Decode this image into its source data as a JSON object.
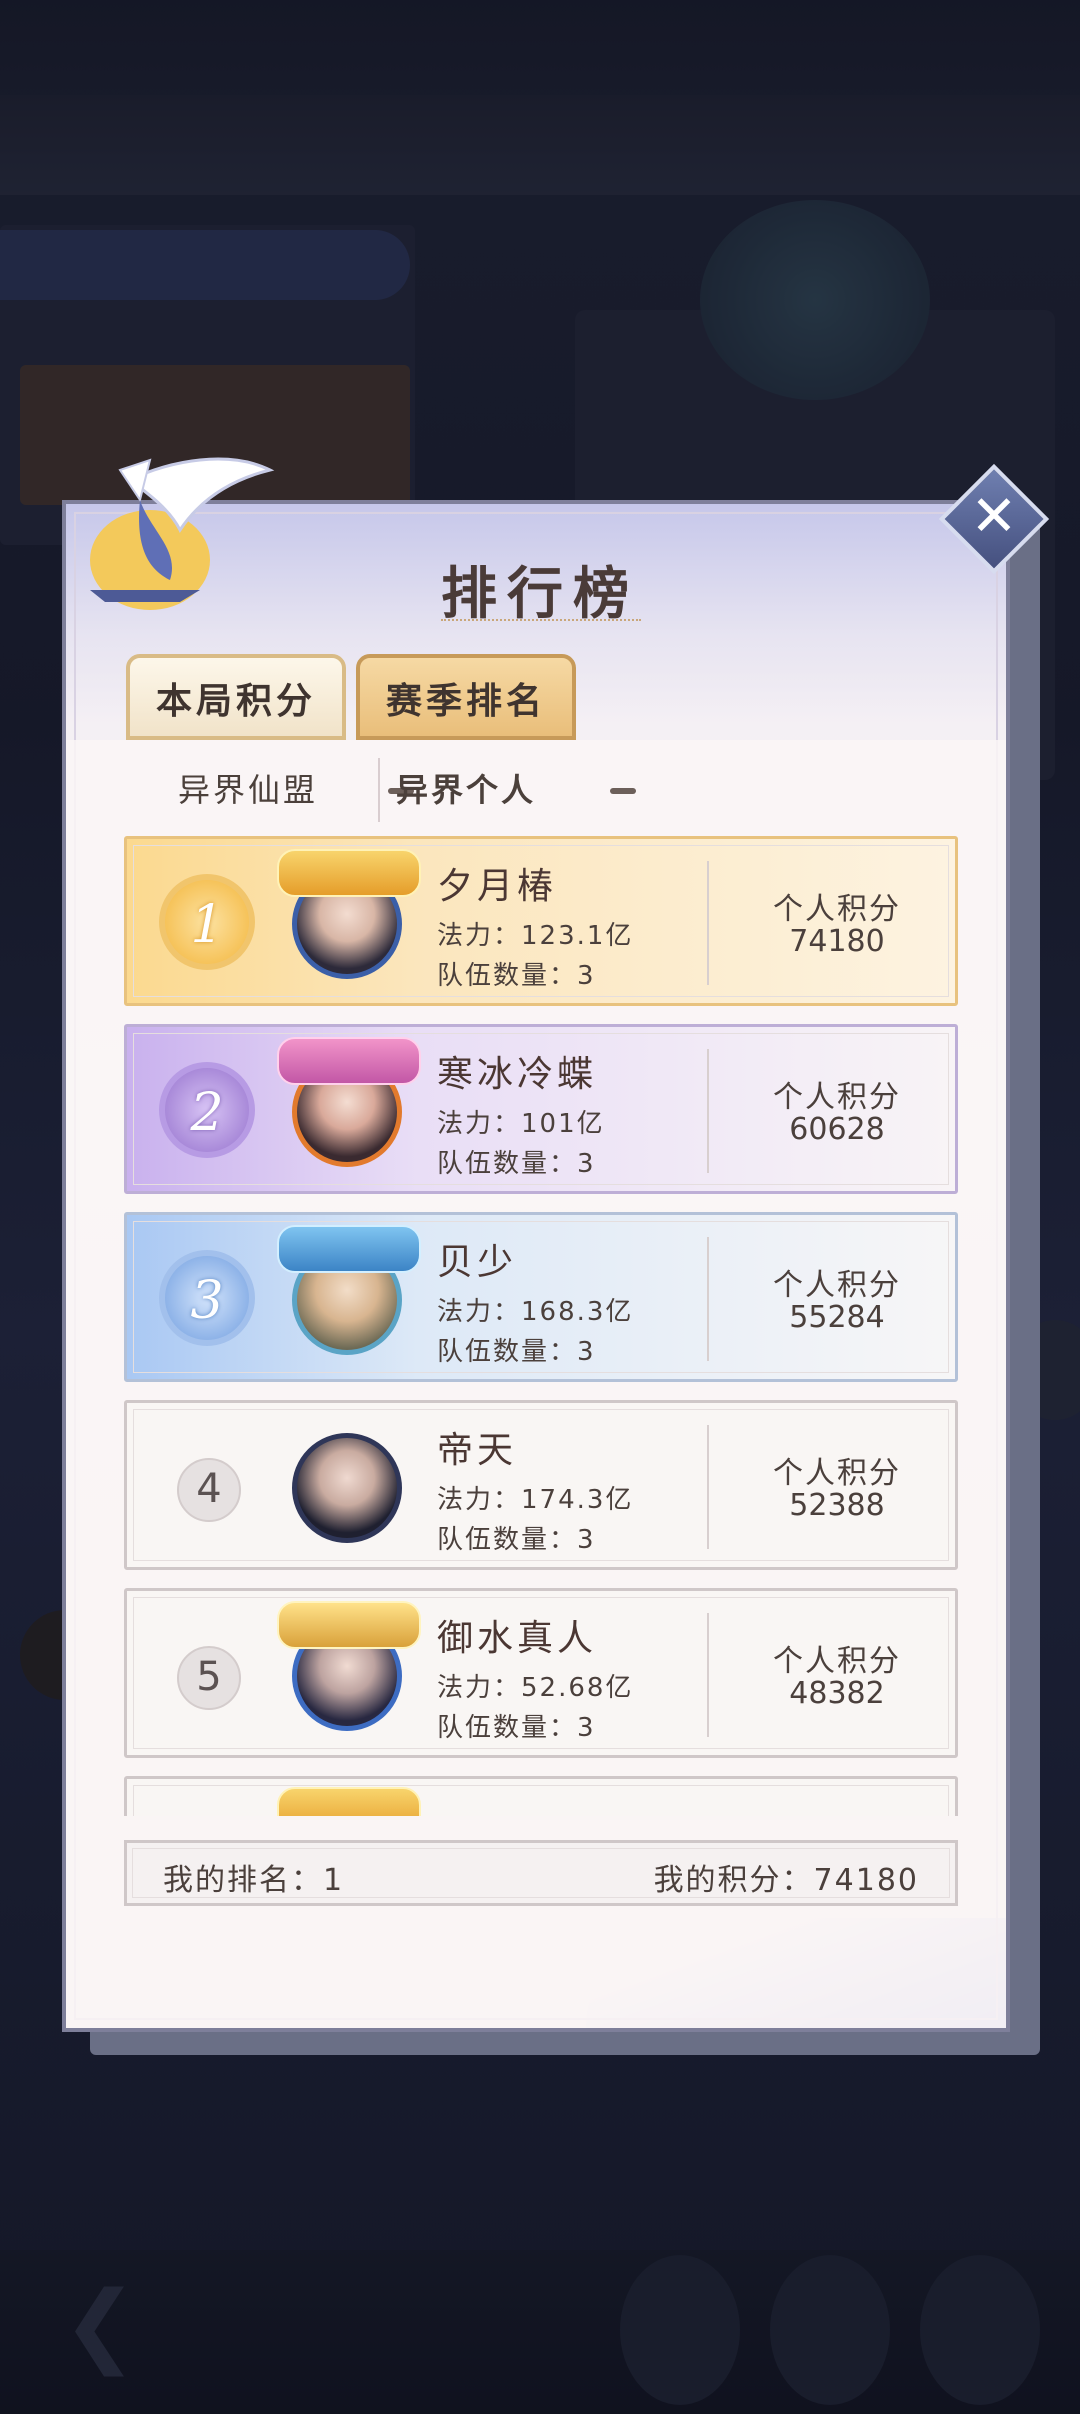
{
  "modal": {
    "title": "排行榜",
    "tabs": [
      {
        "label": "本局积分",
        "active": false
      },
      {
        "label": "赛季排名",
        "active": true
      }
    ],
    "subtabs": [
      {
        "label": "异界仙盟",
        "active": false
      },
      {
        "label": "异界个人",
        "active": true
      }
    ],
    "rows": [
      {
        "rank": "1",
        "name": "夕月椿",
        "power": "法力：123.1亿",
        "team": "队伍数量：3",
        "score_label": "个人积分",
        "score": "74180",
        "tier": "gold"
      },
      {
        "rank": "2",
        "name": "寒冰冷蝶",
        "power": "法力：101亿",
        "team": "队伍数量：3",
        "score_label": "个人积分",
        "score": "60628",
        "tier": "purple"
      },
      {
        "rank": "3",
        "name": "贝少",
        "power": "法力：168.3亿",
        "team": "队伍数量：3",
        "score_label": "个人积分",
        "score": "55284",
        "tier": "blue"
      },
      {
        "rank": "4",
        "name": "帝天",
        "power": "法力：174.3亿",
        "team": "队伍数量：3",
        "score_label": "个人积分",
        "score": "52388",
        "tier": "plain"
      },
      {
        "rank": "5",
        "name": "御水真人",
        "power": "法力：52.68亿",
        "team": "队伍数量：3",
        "score_label": "个人积分",
        "score": "48382",
        "tier": "plain"
      }
    ],
    "footer": {
      "my_rank": "我的排名：1",
      "my_score": "我的积分：74180"
    }
  },
  "icons": {
    "close": "close-icon",
    "crane": "crane-icon"
  }
}
